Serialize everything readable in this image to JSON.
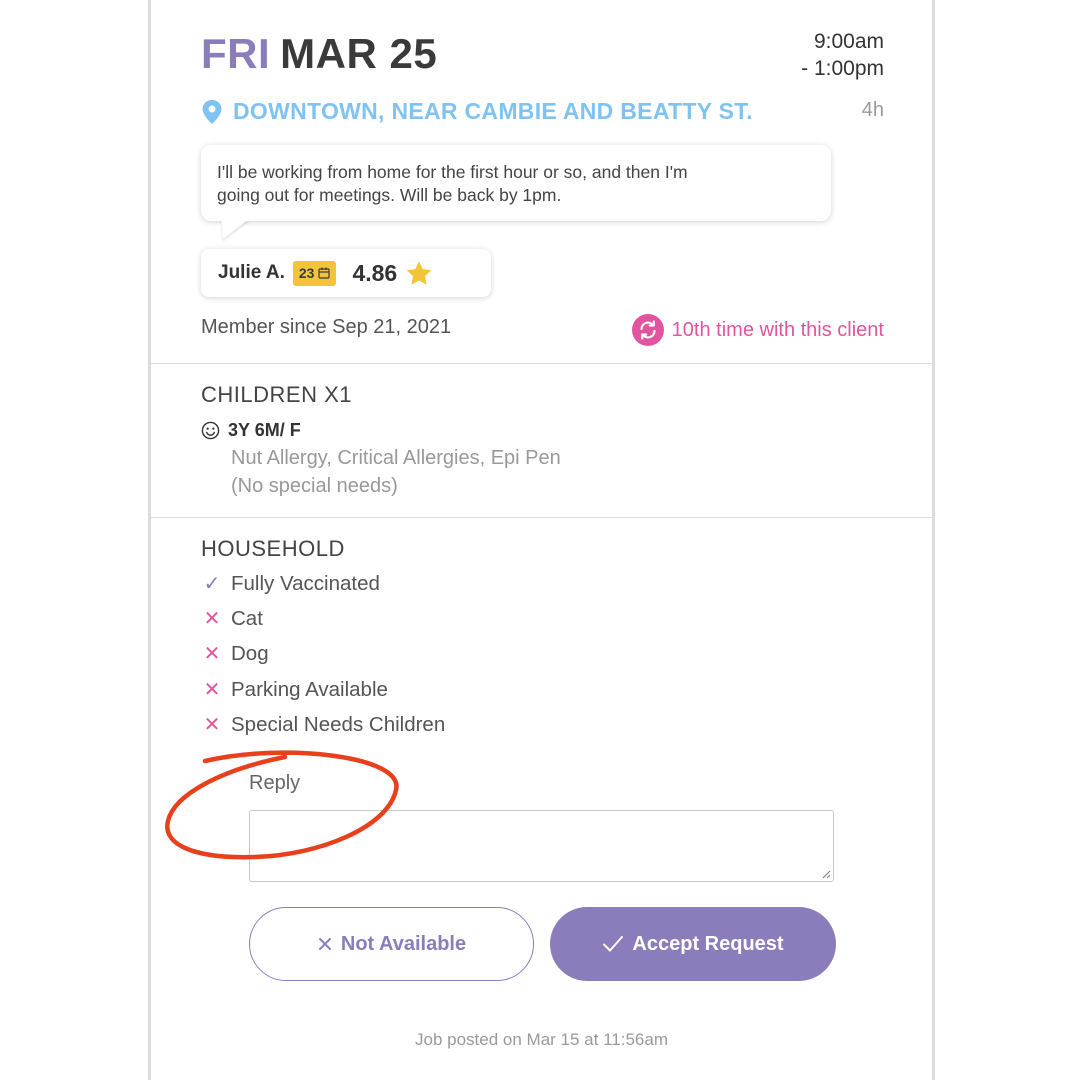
{
  "header": {
    "day_of_week": "FRI",
    "month_day": "MAR 25",
    "time_start": "9:00am",
    "time_end": "- 1:00pm",
    "location": "DOWNTOWN, NEAR CAMBIE AND BEATTY ST.",
    "duration": "4h"
  },
  "message": {
    "line1": "I'll be working from home for the first hour or so, and then I'm",
    "line2": "going out for meetings. Will be back by 1pm."
  },
  "sitter": {
    "name": "Julie A.",
    "badge_count": "23",
    "rating": "4.86",
    "member_since": "Member since Sep 21, 2021",
    "repeat_text": "10th time with this client"
  },
  "children": {
    "title": "CHILDREN X1",
    "child_summary": "3Y 6M/ F",
    "allergies": "Nut Allergy, Critical Allergies, Epi Pen",
    "special_needs": "(No special needs)"
  },
  "household": {
    "title": "HOUSEHOLD",
    "items": [
      {
        "label": "Fully Vaccinated",
        "status": "yes"
      },
      {
        "label": "Cat",
        "status": "no"
      },
      {
        "label": "Dog",
        "status": "no"
      },
      {
        "label": "Parking Available",
        "status": "no"
      },
      {
        "label": "Special Needs Children",
        "status": "no"
      }
    ]
  },
  "reply": {
    "label": "Reply",
    "value": ""
  },
  "actions": {
    "decline_label": "Not Available",
    "accept_label": "Accept Request"
  },
  "footer": {
    "posted": "Job posted on Mar 15 at 11:56am"
  },
  "colors": {
    "purple": "#8b7dbb",
    "pink": "#e2559e",
    "blue": "#7fc3f2",
    "gold": "#f2c43a",
    "annotation": "#e8401c"
  },
  "icons": [
    "location-pin-icon",
    "calendar-icon",
    "star-icon",
    "repeat-icon",
    "smiley-icon",
    "check-icon",
    "cross-icon"
  ]
}
